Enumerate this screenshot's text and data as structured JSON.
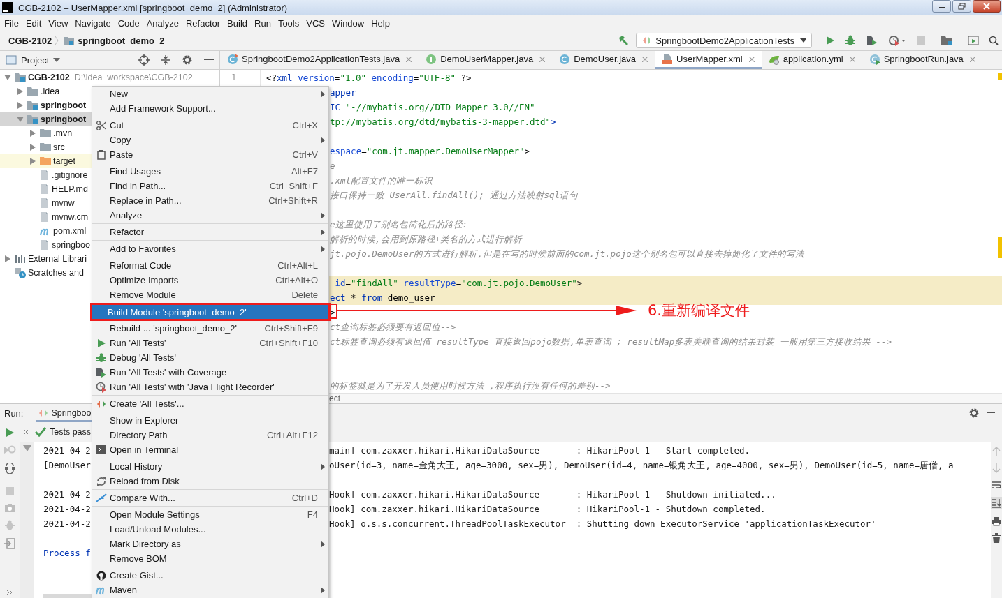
{
  "window": {
    "title": "CGB-2102 – UserMapper.xml [springboot_demo_2] (Administrator)"
  },
  "menu_bar": [
    "File",
    "Edit",
    "View",
    "Navigate",
    "Code",
    "Analyze",
    "Refactor",
    "Build",
    "Run",
    "Tools",
    "VCS",
    "Window",
    "Help"
  ],
  "breadcrumb": [
    {
      "label": "CGB-2102",
      "kind": "project"
    },
    {
      "label": "springboot_demo_2",
      "kind": "module"
    }
  ],
  "run_config": {
    "label": "SpringbootDemo2ApplicationTests"
  },
  "project_panel": {
    "title": "Project",
    "tree": [
      {
        "label": "CGB-2102",
        "hint": "D:\\idea_workspace\\CGB-2102",
        "kind": "project",
        "expanded": true,
        "selected": false,
        "children": [
          {
            "label": ".idea",
            "kind": "folder",
            "expanded": false,
            "selected": false
          },
          {
            "label": "springboot",
            "kind": "module",
            "expanded": false,
            "selected": false
          },
          {
            "label": "springboot",
            "kind": "module",
            "expanded": true,
            "selected": true,
            "children": [
              {
                "label": ".mvn",
                "kind": "folder",
                "expanded": false,
                "selected": false
              },
              {
                "label": "src",
                "kind": "folder",
                "expanded": false,
                "selected": false
              },
              {
                "label": "target",
                "kind": "excluded-folder",
                "expanded": false,
                "selected": false
              },
              {
                "label": ".gitignore",
                "kind": "file",
                "selected": false
              },
              {
                "label": "HELP.md",
                "kind": "file",
                "selected": false
              },
              {
                "label": "mvnw",
                "kind": "file",
                "selected": false
              },
              {
                "label": "mvnw.cm",
                "kind": "file",
                "selected": false
              },
              {
                "label": "pom.xml",
                "kind": "maven-file",
                "selected": false
              },
              {
                "label": "springboo",
                "kind": "file",
                "selected": false
              }
            ]
          }
        ]
      },
      {
        "label": "External Librari",
        "kind": "libraries",
        "expanded": false,
        "selected": false
      },
      {
        "label": "Scratches and",
        "kind": "scratches",
        "selected": false
      }
    ]
  },
  "editor_tabs": [
    {
      "label": "SpringbootDemo2ApplicationTests.java",
      "kind": "test-class",
      "selected": false
    },
    {
      "label": "DemoUserMapper.java",
      "kind": "interface",
      "selected": false
    },
    {
      "label": "DemoUser.java",
      "kind": "class",
      "selected": false
    },
    {
      "label": "UserMapper.xml",
      "kind": "xml",
      "selected": true
    },
    {
      "label": "application.yml",
      "kind": "yml",
      "selected": false
    },
    {
      "label": "SpringbootRun.java",
      "kind": "run-class",
      "selected": false
    }
  ],
  "editor": {
    "line_number": "1",
    "breadcrumb": "ect",
    "lines": [
      {
        "kind": "code",
        "highlighted": false,
        "tokens": [
          {
            "kind": "plain",
            "text": "<?"
          },
          {
            "kind": "tag",
            "text": "xml"
          },
          {
            "kind": "attr",
            "text": " version"
          },
          {
            "kind": "plain",
            "text": "="
          },
          {
            "kind": "value",
            "text": "\"1.0\""
          },
          {
            "kind": "attr",
            "text": " encoding"
          },
          {
            "kind": "plain",
            "text": "="
          },
          {
            "kind": "value",
            "text": "\"UTF-8\""
          },
          {
            "kind": "plain",
            "text": " ?>"
          }
        ]
      },
      {
        "kind": "code",
        "highlighted": false,
        "tokens": [
          {
            "kind": "tag",
            "text": "apper"
          }
        ]
      },
      {
        "kind": "code",
        "highlighted": false,
        "tokens": [
          {
            "kind": "tag",
            "text": "IC"
          },
          {
            "kind": "value",
            "text": " \"-//mybatis.org//DTD Mapper 3.0//EN\""
          }
        ]
      },
      {
        "kind": "code",
        "highlighted": false,
        "tokens": [
          {
            "kind": "value",
            "text": "tp://mybatis.org/dtd/mybatis-3-mapper.dtd\""
          },
          {
            "kind": "tag",
            "text": ">"
          }
        ]
      },
      {
        "kind": "blank",
        "highlighted": false
      },
      {
        "kind": "code",
        "highlighted": false,
        "tokens": [
          {
            "kind": "attr",
            "text": "espace"
          },
          {
            "kind": "plain",
            "text": "="
          },
          {
            "kind": "value",
            "text": "\"com.jt.mapper.DemoUserMapper\""
          },
          {
            "kind": "plain",
            "text": ">"
          }
        ]
      },
      {
        "kind": "code",
        "highlighted": false,
        "tokens": [
          {
            "kind": "comment",
            "text": "e"
          }
        ]
      },
      {
        "kind": "code",
        "highlighted": false,
        "tokens": [
          {
            "kind": "comment",
            "text": ".xml配置文件的唯一标识"
          }
        ]
      },
      {
        "kind": "code",
        "highlighted": false,
        "tokens": [
          {
            "kind": "comment",
            "text": "接口保持一致 UserAll.findAll(); 通过方法映射sql语句"
          }
        ]
      },
      {
        "kind": "blank",
        "highlighted": false
      },
      {
        "kind": "code",
        "highlighted": false,
        "tokens": [
          {
            "kind": "comment",
            "text": "e这里使用了别名包简化后的路径:"
          }
        ]
      },
      {
        "kind": "code",
        "highlighted": false,
        "tokens": [
          {
            "kind": "comment",
            "text": "解析的时候,会用到原路径+类名的方式进行解析"
          }
        ]
      },
      {
        "kind": "code",
        "highlighted": false,
        "tokens": [
          {
            "kind": "comment",
            "text": "jt.pojo.DemoUser的方式进行解析,但是在写的时候前面的com.jt.pojo这个别名包可以直接去掉简化了文件的写法"
          }
        ]
      },
      {
        "kind": "blank",
        "highlighted": false
      },
      {
        "kind": "code",
        "highlighted": true,
        "tokens": [
          {
            "kind": "attr",
            "text": " id"
          },
          {
            "kind": "plain",
            "text": "="
          },
          {
            "kind": "value",
            "text": "\"findAll\""
          },
          {
            "kind": "attr",
            "text": " resultType"
          },
          {
            "kind": "plain",
            "text": "="
          },
          {
            "kind": "value",
            "text": "\"com.jt.pojo.DemoUser\""
          },
          {
            "kind": "plain",
            "text": ">"
          }
        ]
      },
      {
        "kind": "code",
        "highlighted": true,
        "tokens": [
          {
            "kind": "keyword",
            "text": "ect"
          },
          {
            "kind": "plain",
            "text": " * "
          },
          {
            "kind": "keyword",
            "text": "from"
          },
          {
            "kind": "plain",
            "text": " demo_user"
          }
        ]
      },
      {
        "kind": "code",
        "highlighted": false,
        "tokens": [
          {
            "kind": "plain",
            "text": ">"
          }
        ]
      },
      {
        "kind": "code",
        "highlighted": false,
        "tokens": [
          {
            "kind": "comment",
            "text": "ct查询标签必须要有返回值-->"
          }
        ]
      },
      {
        "kind": "code",
        "highlighted": false,
        "tokens": [
          {
            "kind": "comment",
            "text": "ct标签查询必须有返回值 resultType 直接返回pojo数据,单表查询 ; resultMap多表关联查询的结果封装 一般用第三方接收结果 -->"
          }
        ]
      },
      {
        "kind": "blank",
        "highlighted": false
      },
      {
        "kind": "blank",
        "highlighted": false
      },
      {
        "kind": "code",
        "highlighted": false,
        "tokens": [
          {
            "kind": "comment",
            "text": "的标签就是为了开发人员使用时候方法 ,程序执行没有任何的差别-->"
          }
        ]
      }
    ]
  },
  "context_menu": {
    "groups": [
      [
        {
          "label": "New",
          "submenu": true,
          "selected": false
        },
        {
          "label": "Add Framework Support...",
          "submenu": false,
          "selected": false
        }
      ],
      [
        {
          "label": "Cut",
          "shortcut": "Ctrl+X",
          "submenu": false,
          "selected": false
        },
        {
          "label": "Copy",
          "submenu": true,
          "selected": false
        },
        {
          "label": "Paste",
          "shortcut": "Ctrl+V",
          "submenu": false,
          "selected": false
        }
      ],
      [
        {
          "label": "Find Usages",
          "shortcut": "Alt+F7",
          "submenu": false,
          "selected": false
        },
        {
          "label": "Find in Path...",
          "shortcut": "Ctrl+Shift+F",
          "submenu": false,
          "selected": false
        },
        {
          "label": "Replace in Path...",
          "shortcut": "Ctrl+Shift+R",
          "submenu": false,
          "selected": false
        },
        {
          "label": "Analyze",
          "submenu": true,
          "selected": false
        }
      ],
      [
        {
          "label": "Refactor",
          "submenu": true,
          "selected": false
        }
      ],
      [
        {
          "label": "Add to Favorites",
          "submenu": true,
          "selected": false
        }
      ],
      [
        {
          "label": "Reformat Code",
          "shortcut": "Ctrl+Alt+L",
          "submenu": false,
          "selected": false
        },
        {
          "label": "Optimize Imports",
          "shortcut": "Ctrl+Alt+O",
          "submenu": false,
          "selected": false
        },
        {
          "label": "Remove Module",
          "shortcut": "Delete",
          "submenu": false,
          "selected": false
        }
      ],
      [
        {
          "label": "Build Module 'springboot_demo_2'",
          "submenu": false,
          "selected": true
        },
        {
          "label": "Rebuild ... 'springboot_demo_2'",
          "shortcut": "Ctrl+Shift+F9",
          "submenu": false,
          "selected": false
        },
        {
          "label": "Run 'All Tests'",
          "shortcut": "Ctrl+Shift+F10",
          "submenu": false,
          "selected": false
        },
        {
          "label": "Debug 'All Tests'",
          "submenu": false,
          "selected": false
        },
        {
          "label": "Run 'All Tests' with Coverage",
          "submenu": false,
          "selected": false
        },
        {
          "label": "Run 'All Tests' with 'Java Flight Recorder'",
          "submenu": false,
          "selected": false
        }
      ],
      [
        {
          "label": "Create 'All Tests'...",
          "submenu": false,
          "selected": false
        }
      ],
      [
        {
          "label": "Show in Explorer",
          "submenu": false,
          "selected": false
        },
        {
          "label": "Directory Path",
          "shortcut": "Ctrl+Alt+F12",
          "submenu": false,
          "selected": false
        },
        {
          "label": "Open in Terminal",
          "submenu": false,
          "selected": false
        }
      ],
      [
        {
          "label": "Local History",
          "submenu": true,
          "selected": false
        },
        {
          "label": "Reload from Disk",
          "submenu": false,
          "selected": false
        }
      ],
      [
        {
          "label": "Compare With...",
          "shortcut": "Ctrl+D",
          "submenu": false,
          "selected": false
        }
      ],
      [
        {
          "label": "Open Module Settings",
          "shortcut": "F4",
          "submenu": false,
          "selected": false
        },
        {
          "label": "Load/Unload Modules...",
          "submenu": false,
          "selected": false
        },
        {
          "label": "Mark Directory as",
          "submenu": true,
          "selected": false
        },
        {
          "label": "Remove BOM",
          "submenu": false,
          "selected": false
        }
      ],
      [
        {
          "label": "Create Gist...",
          "submenu": false,
          "selected": false
        },
        {
          "label": "Maven",
          "submenu": true,
          "selected": false
        }
      ]
    ]
  },
  "annotation": {
    "text": "6.重新编译文件"
  },
  "run_panel": {
    "label": "Run:",
    "tab": "Springboo",
    "status": "Tests pass",
    "console": [
      {
        "kind": "log",
        "left": "2021-04-2",
        "right": "main] com.zaxxer.hikari.HikariDataSource       : HikariPool-1 - Start completed."
      },
      {
        "kind": "log",
        "left": "[DemoUser",
        "right": "oUser(id=3, name=金角大王, age=3000, sex=男), DemoUser(id=4, name=银角大王, age=4000, sex=男), DemoUser(id=5, name=唐僧, a"
      },
      {
        "kind": "blank"
      },
      {
        "kind": "log",
        "left": "2021-04-2",
        "right": "Hook] com.zaxxer.hikari.HikariDataSource       : HikariPool-1 - Shutdown initiated..."
      },
      {
        "kind": "log",
        "left": "2021-04-2",
        "right": "Hook] com.zaxxer.hikari.HikariDataSource       : HikariPool-1 - Shutdown completed."
      },
      {
        "kind": "log",
        "left": "2021-04-2",
        "right": "Hook] o.s.s.concurrent.ThreadPoolTaskExecutor  : Shutting down ExecutorService 'applicationTaskExecutor'"
      },
      {
        "kind": "blank"
      },
      {
        "kind": "exit",
        "left": "Process f"
      }
    ]
  }
}
